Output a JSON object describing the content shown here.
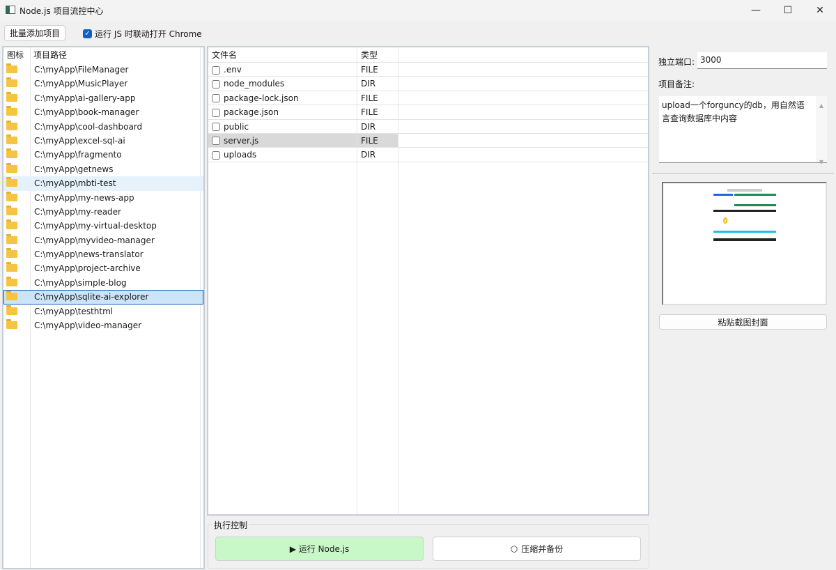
{
  "window": {
    "title": "Node.js 项目流控中心",
    "minimize": "—",
    "maximize": "☐",
    "close": "✕"
  },
  "toolbar": {
    "batch_add": "批量添加项目",
    "open_chrome_label": "运行 JS 时联动打开 Chrome",
    "open_chrome_checked": true
  },
  "projects": {
    "headers": [
      "图标",
      "项目路径"
    ],
    "selected": "C:\\myApp\\sqlite-ai-explorer",
    "items": [
      "C:\\myApp\\FileManager",
      "C:\\myApp\\MusicPlayer",
      "C:\\myApp\\ai-gallery-app",
      "C:\\myApp\\book-manager",
      "C:\\myApp\\cool-dashboard",
      "C:\\myApp\\excel-sql-ai",
      "C:\\myApp\\fragmento",
      "C:\\myApp\\getnews",
      "C:\\myApp\\mbti-test",
      "C:\\myApp\\my-news-app",
      "C:\\myApp\\my-reader",
      "C:\\myApp\\my-virtual-desktop",
      "C:\\myApp\\myvideo-manager",
      "C:\\myApp\\news-translator",
      "C:\\myApp\\project-archive",
      "C:\\myApp\\simple-blog",
      "C:\\myApp\\sqlite-ai-explorer",
      "C:\\myApp\\testhtml",
      "C:\\myApp\\video-manager"
    ]
  },
  "files": {
    "headers": [
      "文件名",
      "类型"
    ],
    "rows": [
      {
        "name": ".env",
        "type": "FILE"
      },
      {
        "name": "node_modules",
        "type": "DIR"
      },
      {
        "name": "package-lock.json",
        "type": "FILE"
      },
      {
        "name": "package.json",
        "type": "FILE"
      },
      {
        "name": "public",
        "type": "DIR"
      },
      {
        "name": "server.js",
        "type": "FILE"
      },
      {
        "name": "uploads",
        "type": "DIR"
      }
    ]
  },
  "control": {
    "group_title": "执行控制",
    "run": "▶ 运行 Node.js",
    "backup": "压缩并备份"
  },
  "side": {
    "port_label": "独立端口:",
    "port_value": "3000",
    "notes_label": "项目备注:",
    "notes": "upload一个forguncy的db，用自然语言查询数据库中内容",
    "paste_cover": "粘贴截图封面"
  }
}
